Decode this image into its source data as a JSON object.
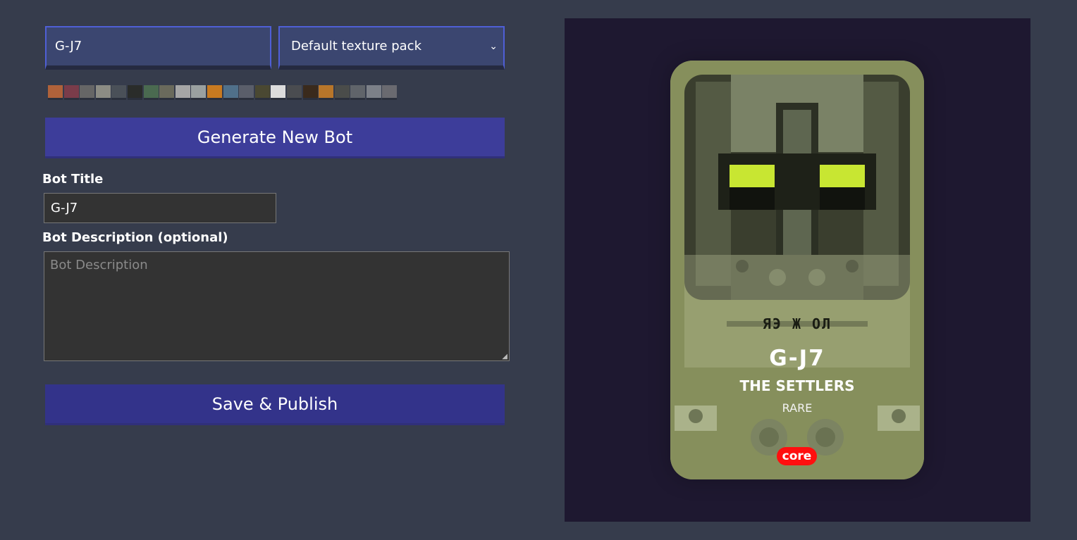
{
  "controls": {
    "bot_name_value": "G-J7",
    "texture_pack_selected": "Default texture pack"
  },
  "swatch_colors": [
    "#b0623a",
    "#7a3c4a",
    "#666666",
    "#8c8c84",
    "#4a5058",
    "#2a2c2a",
    "#4a6a50",
    "#6a6a5c",
    "#a6a6a6",
    "#9aa0a0",
    "#c87a20",
    "#50708a",
    "#5a5e6a",
    "#4a4832",
    "#dcdcdc",
    "#4a4c50",
    "#3a2a1c",
    "#b8762a",
    "#4a4c4a",
    "#60646a",
    "#7c8088",
    "#6a6a70"
  ],
  "buttons": {
    "generate_label": "Generate New Bot",
    "publish_label": "Save & Publish"
  },
  "form": {
    "title_label": "Bot Title",
    "title_value": "G-J7",
    "description_label": "Bot Description (optional)",
    "description_placeholder": "Bot Description"
  },
  "card": {
    "glyphs": "ЯЭ Ж ОЛ",
    "name": "G-J7",
    "faction": "THE SETTLERS",
    "rarity": "RARE",
    "badge": "core",
    "badge_color": "#ff0f0f",
    "eye_color": "#c8e632",
    "body_color": "#8a9460"
  }
}
